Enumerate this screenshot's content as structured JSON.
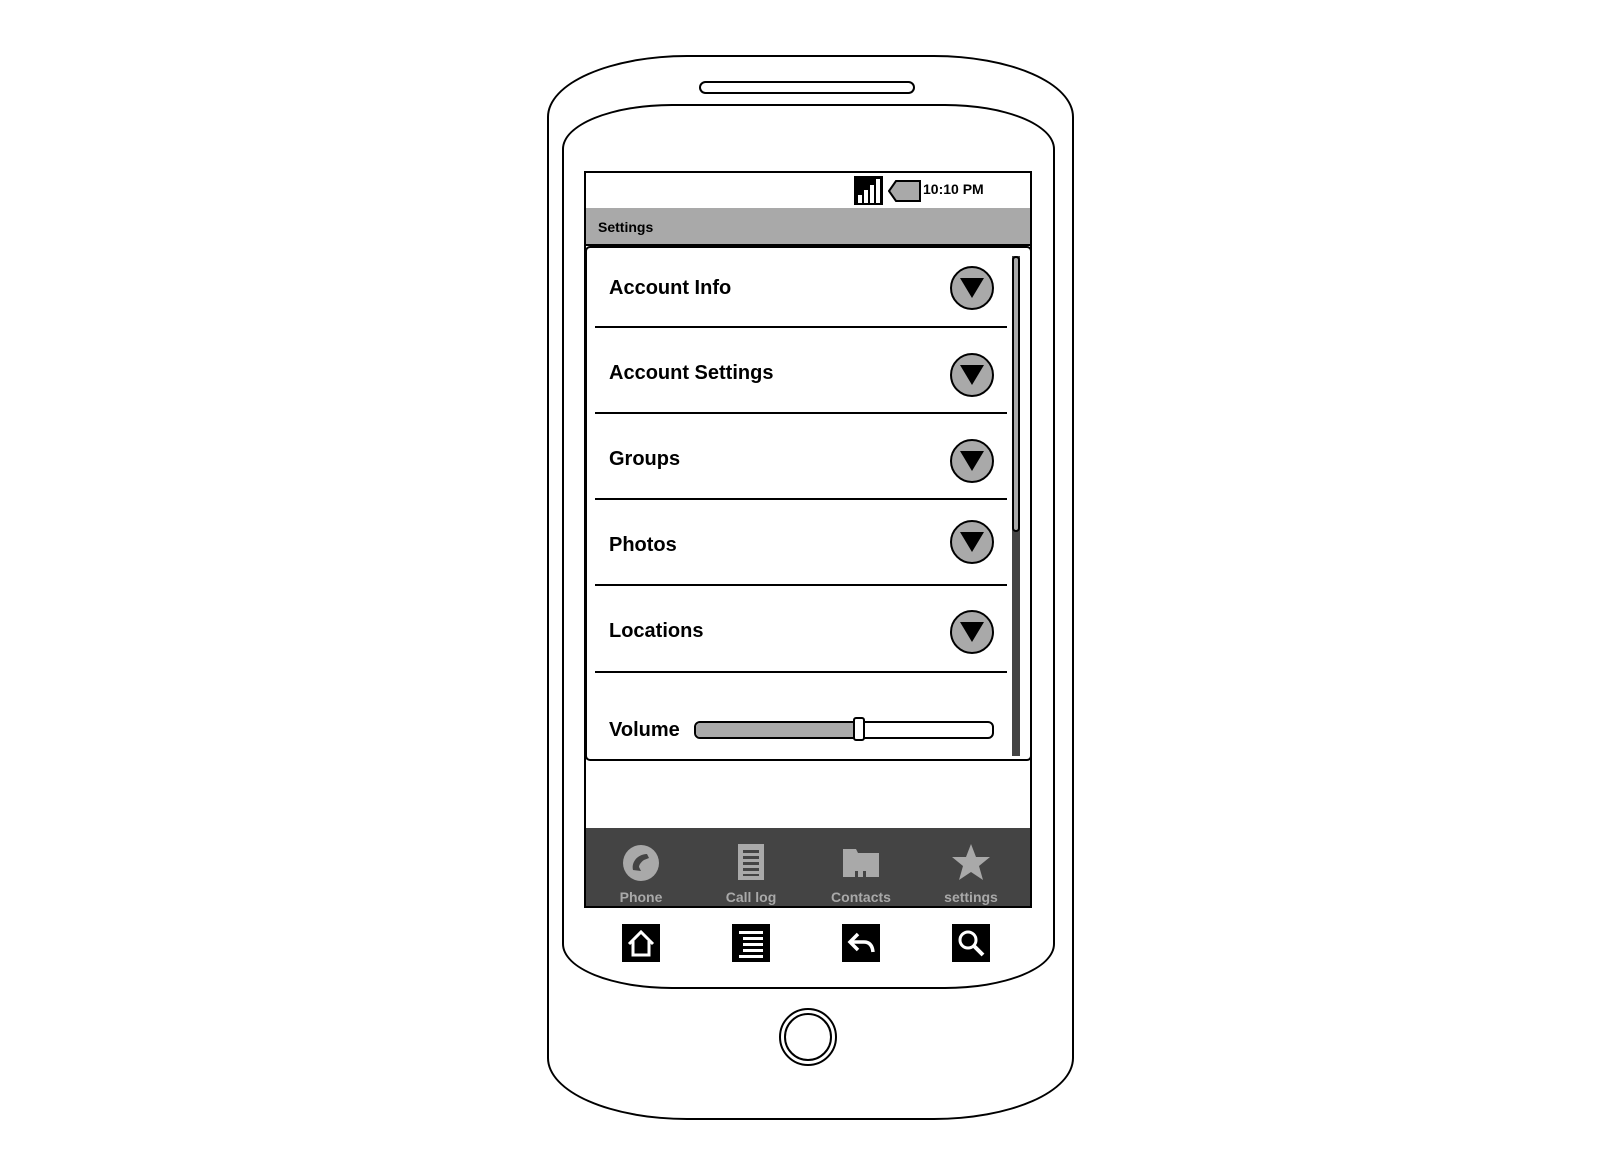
{
  "status_bar": {
    "time": "10:10 PM",
    "signal_icon": "signal-strength-icon",
    "battery_icon": "battery-icon"
  },
  "title_bar": {
    "title": "Settings"
  },
  "settings_list": {
    "items": [
      {
        "label": "Account Info",
        "icon": "expand-down-icon"
      },
      {
        "label": "Account Settings",
        "icon": "expand-down-icon"
      },
      {
        "label": "Groups",
        "icon": "expand-down-icon"
      },
      {
        "label": "Photos",
        "icon": "expand-down-icon"
      },
      {
        "label": "Locations",
        "icon": "expand-down-icon"
      }
    ],
    "volume": {
      "label": "Volume",
      "level": 0.55
    }
  },
  "tab_bar": {
    "tabs": [
      {
        "label": "Phone",
        "icon": "phone-icon"
      },
      {
        "label": "Call log",
        "icon": "call-log-icon"
      },
      {
        "label": "Contacts",
        "icon": "contacts-folder-icon"
      },
      {
        "label": "settings",
        "icon": "star-icon"
      }
    ]
  },
  "hardware_keys": [
    "home-icon",
    "menu-icon",
    "back-icon",
    "search-icon"
  ],
  "colors": {
    "title_bar_bg": "#a9a9a9",
    "tab_bar_bg": "#444444",
    "tab_foreground": "#a9a9a9",
    "outline": "#000000"
  }
}
